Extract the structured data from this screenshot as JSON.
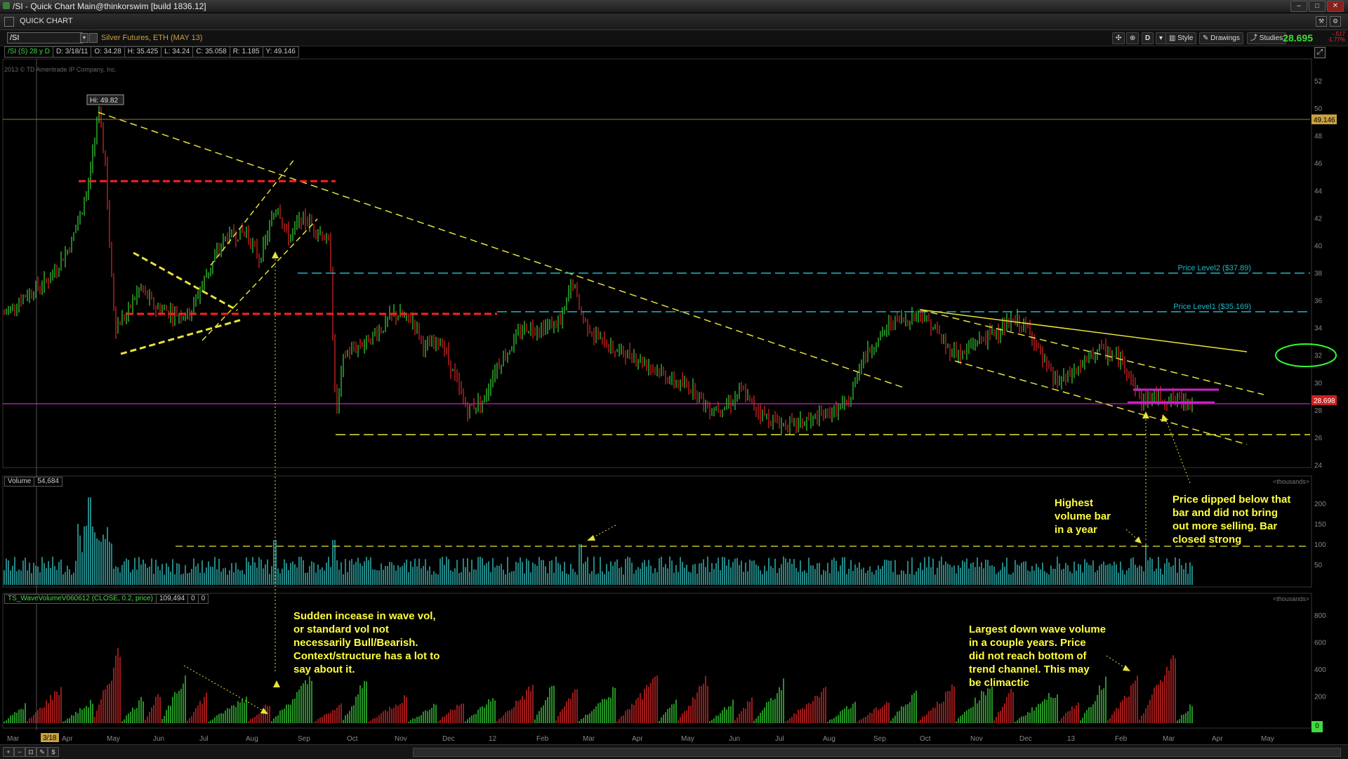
{
  "window": {
    "title": "/SI - Quick Chart Main@thinkorswim [build 1836.12]",
    "tab_label": "QUICK CHART"
  },
  "symbol_bar": {
    "symbol_value": "/SI",
    "description": "Silver Futures, ETH (MAY 13)",
    "aggregation": "D",
    "style_label": "Style",
    "drawings_label": "Drawings",
    "studies_label": "Studies",
    "last_price": "28.695",
    "change_1": "-.517",
    "change_2": "-1.77%"
  },
  "info_bar": {
    "symbol": "/SI (S) 28 y D",
    "date": "D: 3/18/11",
    "open": "O: 34.28",
    "high": "H: 35.425",
    "low": "L: 34.24",
    "close": "C: 35.058",
    "range": "R: 1.185",
    "y": "Y: 49.146"
  },
  "copyright": "2013 © TD Ameritrade IP Company, Inc.",
  "price_panel": {
    "y_ticks": [
      "52",
      "50",
      "48",
      "46",
      "44",
      "42",
      "40",
      "38",
      "36",
      "34",
      "32",
      "30",
      "28",
      "26",
      "24"
    ],
    "hi_label": "Hi: 49.82",
    "cursor_badge": "49.146",
    "last_badge": "28.698",
    "level2_label": "Price Level2 ($37.89)",
    "level1_label": "Price Level1 ($35.169)"
  },
  "volume_panel": {
    "label": "Volume",
    "value": "54,684",
    "units": "<thousands>",
    "y_ticks": [
      "200",
      "150",
      "100",
      "50"
    ]
  },
  "wave_panel": {
    "label": "TS_WaveVolumeV060612 (CLOSE, 0.2, price)",
    "value": "109,494",
    "value2": "0",
    "value3": "0",
    "units": "<thousands>",
    "y_ticks": [
      "800",
      "600",
      "400",
      "200",
      "0"
    ]
  },
  "x_axis": {
    "labels": [
      "Mar",
      "3/18",
      "Apr",
      "May",
      "Jun",
      "Jul",
      "Aug",
      "Sep",
      "Oct",
      "Nov",
      "Dec",
      "12",
      "Feb",
      "Mar",
      "Apr",
      "May",
      "Jun",
      "Jul",
      "Aug",
      "Sep",
      "Oct",
      "Nov",
      "Dec",
      "13",
      "Feb",
      "Mar",
      "Apr",
      "May"
    ]
  },
  "annotations": {
    "wave_vol_note": "Sudden incease in wave vol,\nor standard vol not\nnecessarily Bull/Bearish.\nContext/structure has a lot to\nsay about it.",
    "highest_volume_note": "Highest\nvolume bar\nin a year",
    "price_dipped_note": "Price dipped below that\nbar and did not bring\nout more selling.  Bar\nclosed strong",
    "down_wave_note": "Largest down wave volume\nin a couple years.  Price\ndid not reach bottom of\ntrend channel.  This may\nbe climactic"
  },
  "colors": {
    "up_bar": "#2fb82f",
    "down_bar": "#c42020",
    "volume_bar": "#2aa8a8",
    "trend_line": "#e6e23a",
    "support_red": "#ff2020",
    "level_cyan": "#1fb6c8",
    "magenta": "#d020d0",
    "circle": "#30ff30"
  }
}
